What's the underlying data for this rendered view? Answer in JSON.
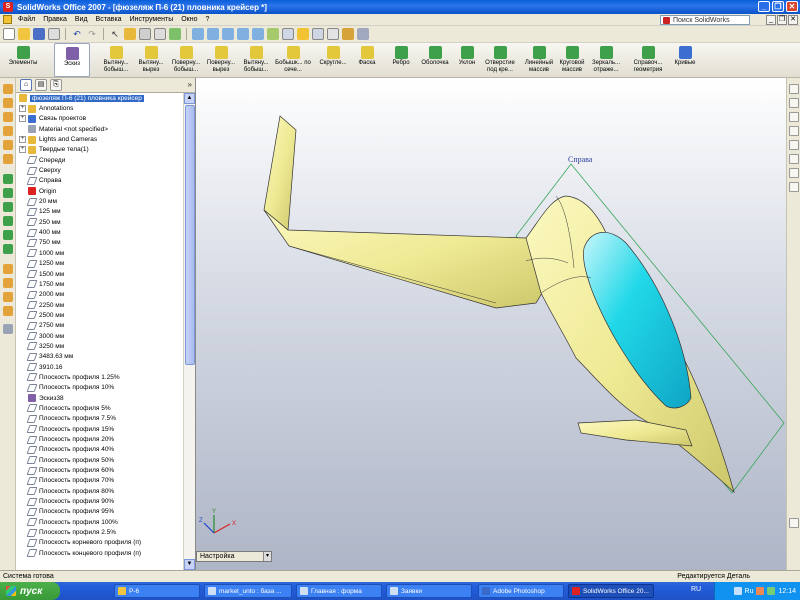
{
  "window": {
    "title": "SolidWorks Office 2007 - [фюзеляж П-6 (21) пловника крейсер *]",
    "app_icon": "solidworks-logo-icon"
  },
  "menubar": {
    "items": [
      "Файл",
      "Правка",
      "Вид",
      "Вставка",
      "Инструменты",
      "Окно",
      "?"
    ],
    "search_placeholder": "Поиск SolidWorks"
  },
  "command_manager": {
    "elements_label": "Элементы",
    "sketch_label": "Эскиз",
    "commands": [
      "Вытяну... бобыш...",
      "Вытяну... вырез",
      "Поверну... бобыш...",
      "Поверну... вырез",
      "Вытяну... бобыш...",
      "Бобышк... по сече...",
      "Скругле...",
      "Фаска",
      "Ребро",
      "Оболочка",
      "Уклон",
      "Отверстие под кре...",
      "Линейный массив",
      "Круговой массив",
      "Зеркаль... отраже...",
      "Справоч... геометрия",
      "Кривые"
    ]
  },
  "feature_tree": {
    "root": "фюзеляж П-6 (21) пловника крейсер",
    "items": [
      {
        "label": "Annotations",
        "expandable": true,
        "icon": "annotations-icon"
      },
      {
        "label": "Связь проектов",
        "expandable": true,
        "icon": "design-binder-icon"
      },
      {
        "label": "Material <not specified>",
        "expandable": false,
        "icon": "material-icon"
      },
      {
        "label": "Lights and Cameras",
        "expandable": true,
        "icon": "lights-icon"
      },
      {
        "label": "Твердые тела(1)",
        "expandable": true,
        "icon": "solid-bodies-icon"
      },
      {
        "label": "Спереди",
        "expandable": false,
        "icon": "plane-icon"
      },
      {
        "label": "Сверху",
        "expandable": false,
        "icon": "plane-icon"
      },
      {
        "label": "Справа",
        "expandable": false,
        "icon": "plane-icon"
      },
      {
        "label": "Origin",
        "expandable": false,
        "icon": "origin-icon"
      },
      {
        "label": "20 мм",
        "expandable": false,
        "icon": "plane-icon"
      },
      {
        "label": "125 мм",
        "expandable": false,
        "icon": "plane-icon"
      },
      {
        "label": "250 мм",
        "expandable": false,
        "icon": "plane-icon"
      },
      {
        "label": "400 мм",
        "expandable": false,
        "icon": "plane-icon"
      },
      {
        "label": "750 мм",
        "expandable": false,
        "icon": "plane-icon"
      },
      {
        "label": "1000 мм",
        "expandable": false,
        "icon": "plane-icon"
      },
      {
        "label": "1250 мм",
        "expandable": false,
        "icon": "plane-icon"
      },
      {
        "label": "1500 мм",
        "expandable": false,
        "icon": "plane-icon"
      },
      {
        "label": "1750 мм",
        "expandable": false,
        "icon": "plane-icon"
      },
      {
        "label": "2000 мм",
        "expandable": false,
        "icon": "plane-icon"
      },
      {
        "label": "2250 мм",
        "expandable": false,
        "icon": "plane-icon"
      },
      {
        "label": "2500 мм",
        "expandable": false,
        "icon": "plane-icon"
      },
      {
        "label": "2750 мм",
        "expandable": false,
        "icon": "plane-icon"
      },
      {
        "label": "3000 мм",
        "expandable": false,
        "icon": "plane-icon"
      },
      {
        "label": "3250 мм",
        "expandable": false,
        "icon": "plane-icon"
      },
      {
        "label": "3483.63 мм",
        "expandable": false,
        "icon": "plane-icon"
      },
      {
        "label": "3910.16",
        "expandable": false,
        "icon": "plane-icon"
      },
      {
        "label": "Плоскость профиля 1.25%",
        "expandable": false,
        "icon": "plane-icon"
      },
      {
        "label": "Плоскость профиля 10%",
        "expandable": false,
        "icon": "plane-icon"
      },
      {
        "label": "Эскиз38",
        "expandable": false,
        "icon": "sketch-icon"
      },
      {
        "label": "Плоскость профиля 5%",
        "expandable": false,
        "icon": "plane-icon"
      },
      {
        "label": "Плоскость профиля 7.5%",
        "expandable": false,
        "icon": "plane-icon"
      },
      {
        "label": "Плоскость профиля 15%",
        "expandable": false,
        "icon": "plane-icon"
      },
      {
        "label": "Плоскость профиля 20%",
        "expandable": false,
        "icon": "plane-icon"
      },
      {
        "label": "Плоскость профиля 40%",
        "expandable": false,
        "icon": "plane-icon"
      },
      {
        "label": "Плоскость профиля 50%",
        "expandable": false,
        "icon": "plane-icon"
      },
      {
        "label": "Плоскость профиля 60%",
        "expandable": false,
        "icon": "plane-icon"
      },
      {
        "label": "Плоскость профиля 70%",
        "expandable": false,
        "icon": "plane-icon"
      },
      {
        "label": "Плоскость профиля 80%",
        "expandable": false,
        "icon": "plane-icon"
      },
      {
        "label": "Плоскость профиля 90%",
        "expandable": false,
        "icon": "plane-icon"
      },
      {
        "label": "Плоскость профиля 95%",
        "expandable": false,
        "icon": "plane-icon"
      },
      {
        "label": "Плоскость профиля 100%",
        "expandable": false,
        "icon": "plane-icon"
      },
      {
        "label": "Плоскость профиля 2.5%",
        "expandable": false,
        "icon": "plane-icon"
      },
      {
        "label": "Плоскость корневого профиля (п)",
        "expandable": false,
        "icon": "plane-icon"
      },
      {
        "label": "Плоскость концевого профиля (п)",
        "expandable": false,
        "icon": "plane-icon"
      }
    ]
  },
  "graphics": {
    "view_label": "Справа",
    "configuration_tab": "Настройка",
    "model_color": "#f0ec9a",
    "canopy_color": "#21d8e8",
    "plane_color": "#3aa55a"
  },
  "statusbar": {
    "left": "Система готова",
    "right": "Редактируется Деталь"
  },
  "taskbar": {
    "start_label": "пуск",
    "tasks": [
      {
        "label": "P-6",
        "icon": "folder-icon",
        "active": false
      },
      {
        "label": "market_unto : база ...",
        "icon": "browser-icon",
        "active": false
      },
      {
        "label": "Главная : форма",
        "icon": "browser-icon",
        "active": false
      },
      {
        "label": "Заявки",
        "icon": "document-icon",
        "active": false
      },
      {
        "label": "Adobe Photoshop",
        "icon": "photoshop-icon",
        "active": false
      },
      {
        "label": "SolidWorks Office 20...",
        "icon": "solidworks-logo-icon",
        "active": true
      }
    ],
    "language": "RU",
    "tray_lang": "Ru",
    "clock": "12:14"
  }
}
